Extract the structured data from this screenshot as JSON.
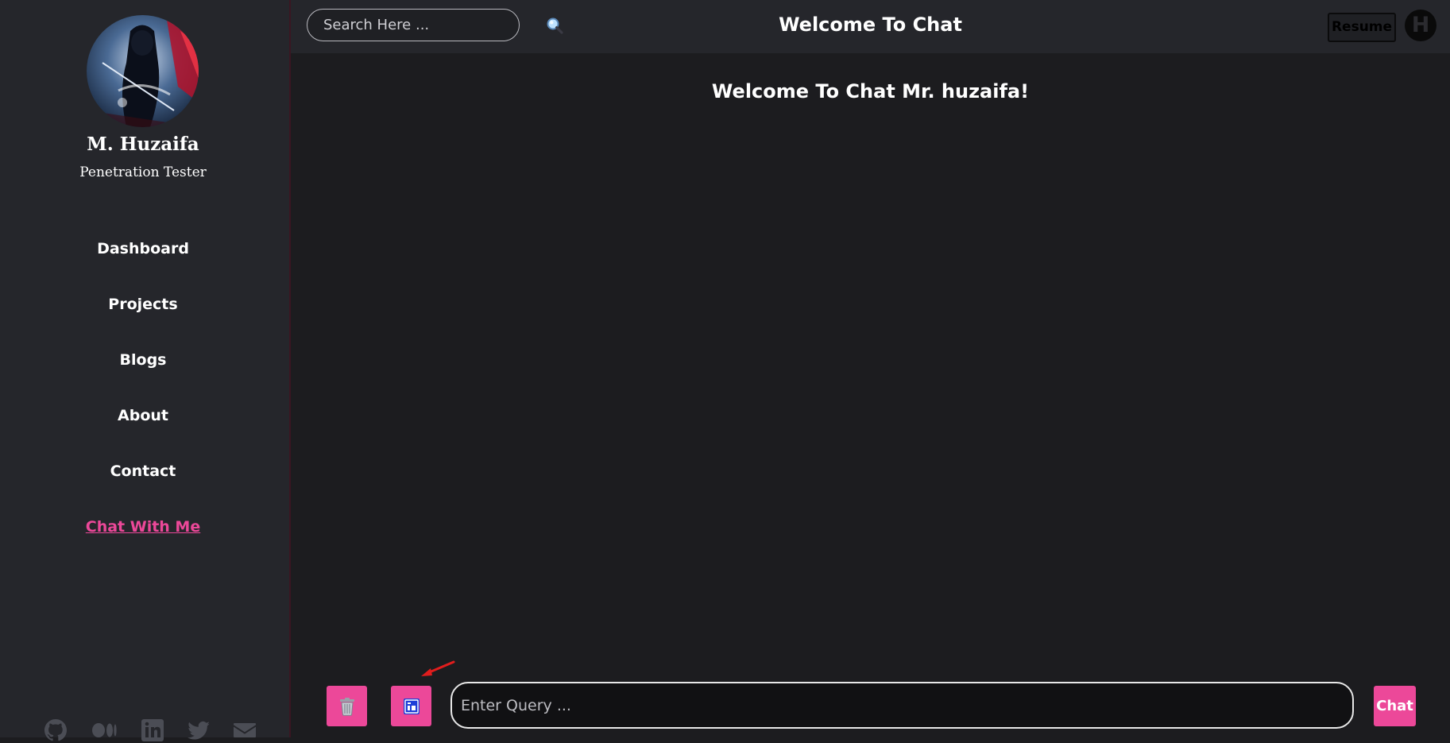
{
  "profile": {
    "name": "M. Huzaifa",
    "title": "Penetration Tester"
  },
  "sidebar": {
    "items": [
      {
        "label": "Dashboard",
        "active": false
      },
      {
        "label": "Projects",
        "active": false
      },
      {
        "label": "Blogs",
        "active": false
      },
      {
        "label": "About",
        "active": false
      },
      {
        "label": "Contact",
        "active": false
      },
      {
        "label": "Chat With Me",
        "active": true
      }
    ],
    "social_icons": [
      "github-icon",
      "medium-icon",
      "linkedin-icon",
      "twitter-icon",
      "email-icon"
    ]
  },
  "header": {
    "search_placeholder": "Search Here ...",
    "title": "Welcome To Chat",
    "resume_label": "Resume",
    "user_initial": "H"
  },
  "chat": {
    "welcome_message": "Welcome To Chat Mr. huzaifa!",
    "query_placeholder": "Enter Query ...",
    "send_label": "Chat",
    "clear_icon": "trash-icon",
    "mode_icon": "id-card-icon"
  },
  "colors": {
    "accent": "#ec4899",
    "sidebar_bg": "#25262b",
    "main_bg": "#1c1c1f",
    "annotation_arrow": "#e11d1d"
  }
}
